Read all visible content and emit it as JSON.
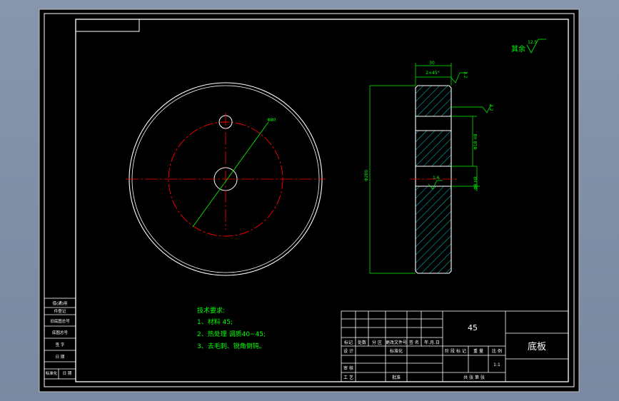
{
  "roughness": {
    "label": "其余",
    "value": "12.5"
  },
  "front_view": {
    "diameter_label": "Φ80"
  },
  "side_view": {
    "dim_width": "30",
    "chamfer": "2×45°",
    "dim_overall": "Φ200",
    "dim_bore_large": "Φ18 H8",
    "dim_bore_small": "Φ8 H8",
    "roughness_top": "3.2",
    "roughness_right": "3.2",
    "roughness_bore": "1.6"
  },
  "tech_requirements": {
    "title": "技术要求:",
    "items": [
      "1、材料 45;",
      "2、热处理 调质40~45;",
      "3、去毛刺、锐角倒钝。"
    ]
  },
  "side_table": {
    "rows": [
      "借(通)用",
      "件登记",
      "旧底图总号",
      "底图总号",
      "签 字",
      "日 期",
      "标准化",
      "日 期"
    ]
  },
  "title_block": {
    "material": "45",
    "part_name": "底板",
    "header": [
      "标记",
      "处数",
      "分 区",
      "更改文件号",
      "签 名",
      "年.月.日"
    ],
    "roles": [
      "设 计",
      "审 核",
      "工 艺"
    ],
    "standardization": "标准化",
    "approval": "批准",
    "stage_headers": [
      "阶 段 标 记",
      "重 量",
      "比 例"
    ],
    "scale": "1:1",
    "sheets": "共  张  第  张"
  }
}
